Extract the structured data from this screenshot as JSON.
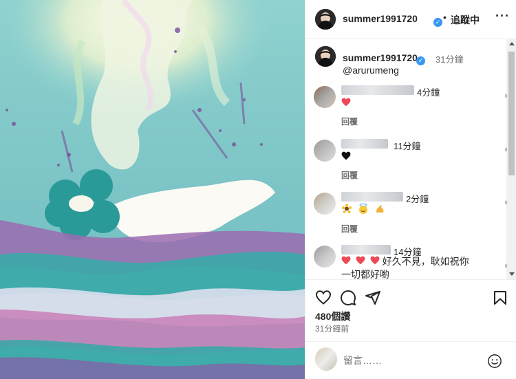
{
  "header": {
    "username": "summer1991720",
    "separator": "•",
    "follow_label": "追蹤中",
    "more_label": "···"
  },
  "caption": {
    "username": "summer1991720",
    "time": "31分鐘",
    "mention": "@arurumeng"
  },
  "comments": [
    {
      "time": "4分鐘",
      "text": "",
      "emoji": [
        "red-heart"
      ],
      "reply": "回覆"
    },
    {
      "time": "11分鐘",
      "text": "",
      "emoji": [
        "black-heart"
      ],
      "reply": "回覆"
    },
    {
      "time": "2分鐘",
      "text": "",
      "emoji": [
        "sunflower",
        "smiling-face-with-halo",
        "flexed-biceps"
      ],
      "reply": "回覆"
    },
    {
      "time": "14分鐘",
      "text": "好久不見，耿如祝你一切都好喲",
      "emoji": [
        "red-heart",
        "red-heart",
        "red-heart"
      ],
      "reply": ""
    }
  ],
  "actions": {
    "likes": "480個讚",
    "post_time": "31分鐘前"
  },
  "add_comment": {
    "placeholder": "留言……"
  },
  "colors": {
    "verified": "#3897f0",
    "heart_red": "#ed4956",
    "muted_text": "#737373"
  }
}
